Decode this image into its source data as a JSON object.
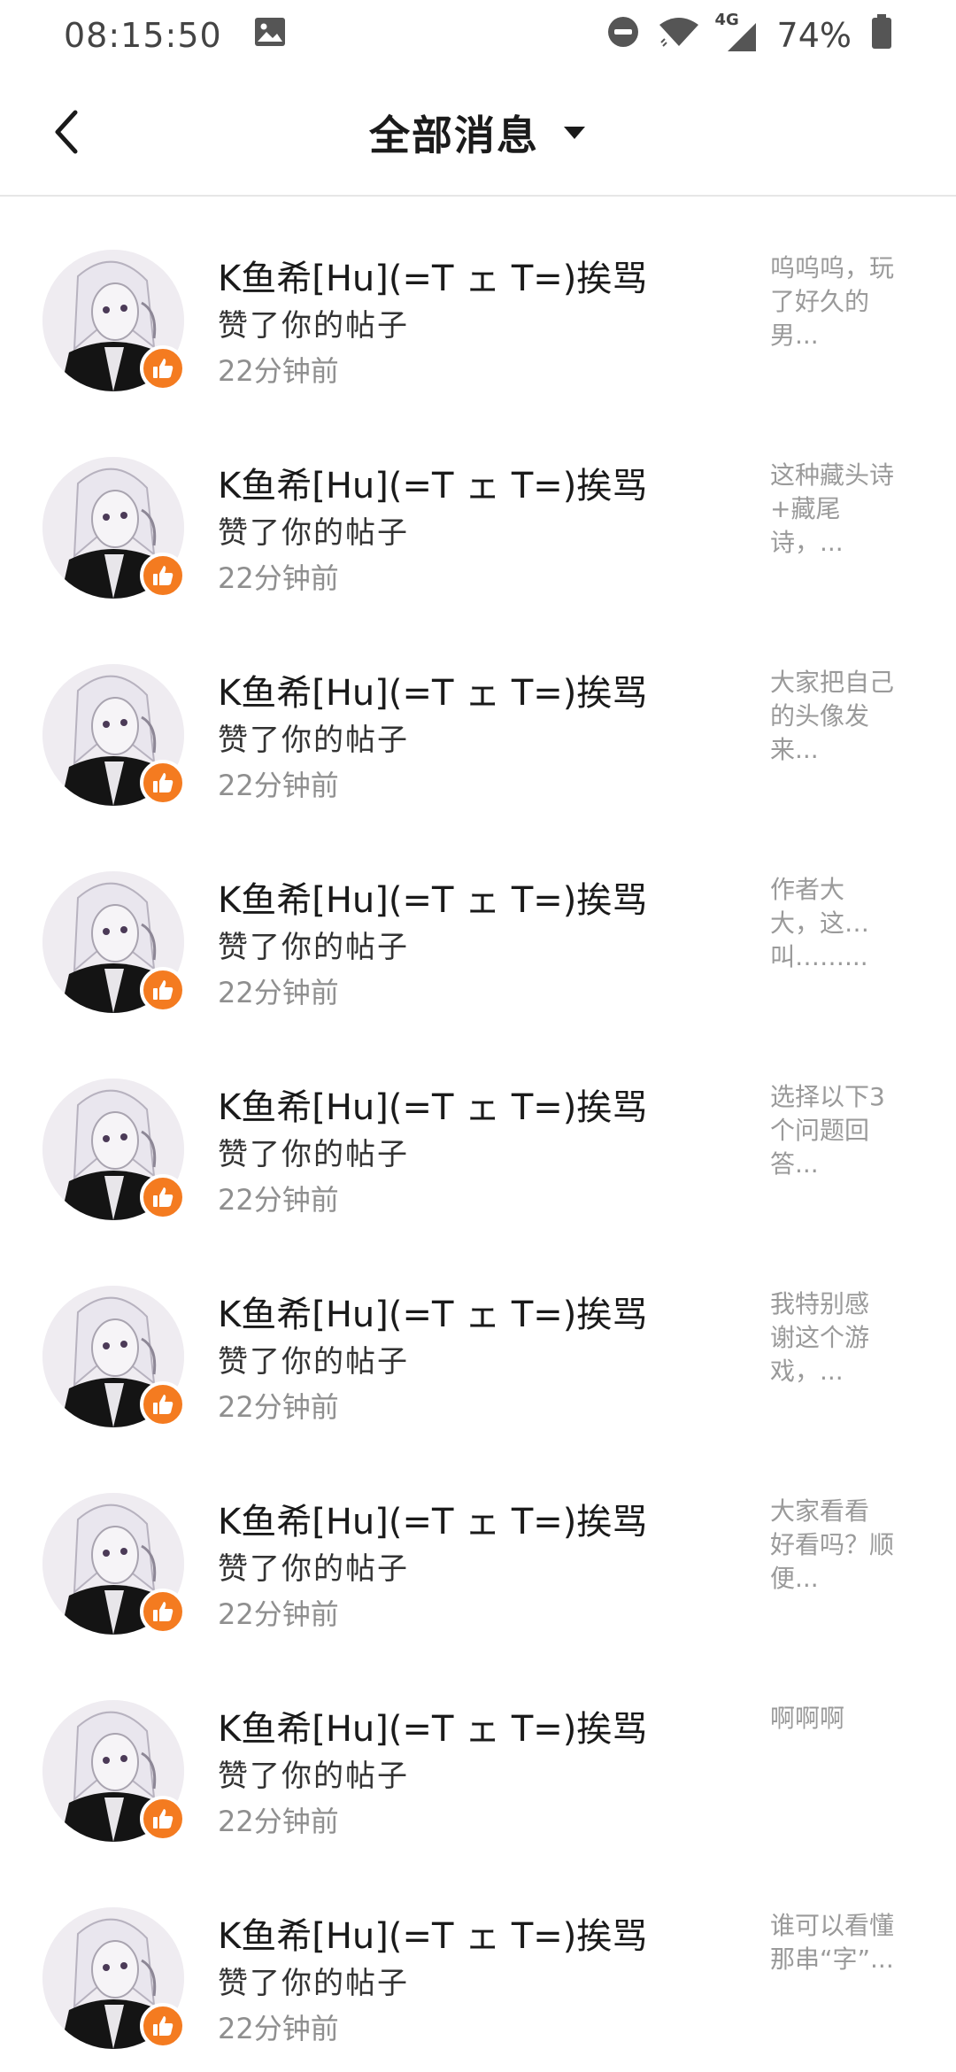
{
  "status_bar": {
    "time": "08:15:50",
    "network": "4G",
    "battery": "74%"
  },
  "header": {
    "title": "全部消息"
  },
  "notifications": [
    {
      "name": "K鱼希[Hu](=T ェ T=)挨骂",
      "action": "赞了你的帖子",
      "time": "22分钟前",
      "preview": "呜呜呜，玩\n了好久的\n男..."
    },
    {
      "name": "K鱼希[Hu](=T ェ T=)挨骂",
      "action": "赞了你的帖子",
      "time": "22分钟前",
      "preview": "这种藏头诗\n+藏尾诗，..."
    },
    {
      "name": "K鱼希[Hu](=T ェ T=)挨骂",
      "action": "赞了你的帖子",
      "time": "22分钟前",
      "preview": "大家把自己\n的头像发\n来..."
    },
    {
      "name": "K鱼希[Hu](=T ェ T=)挨骂",
      "action": "赞了你的帖子",
      "time": "22分钟前",
      "preview": "作者大\n大，这…\n叫……..."
    },
    {
      "name": "K鱼希[Hu](=T ェ T=)挨骂",
      "action": "赞了你的帖子",
      "time": "22分钟前",
      "preview": "选择以下3\n个问题回\n答..."
    },
    {
      "name": "K鱼希[Hu](=T ェ T=)挨骂",
      "action": "赞了你的帖子",
      "time": "22分钟前",
      "preview": "我特别感\n谢这个游\n戏，..."
    },
    {
      "name": "K鱼希[Hu](=T ェ T=)挨骂",
      "action": "赞了你的帖子",
      "time": "22分钟前",
      "preview": "大家看看\n好看吗？顺\n便..."
    },
    {
      "name": "K鱼希[Hu](=T ェ T=)挨骂",
      "action": "赞了你的帖子",
      "time": "22分钟前",
      "preview": "啊啊啊"
    },
    {
      "name": "K鱼希[Hu](=T ェ T=)挨骂",
      "action": "赞了你的帖子",
      "time": "22分钟前",
      "preview": "谁可以看懂\n那串“字”..."
    }
  ],
  "colors": {
    "like_badge": "#f47b20",
    "divider": "#e6e6e6"
  }
}
